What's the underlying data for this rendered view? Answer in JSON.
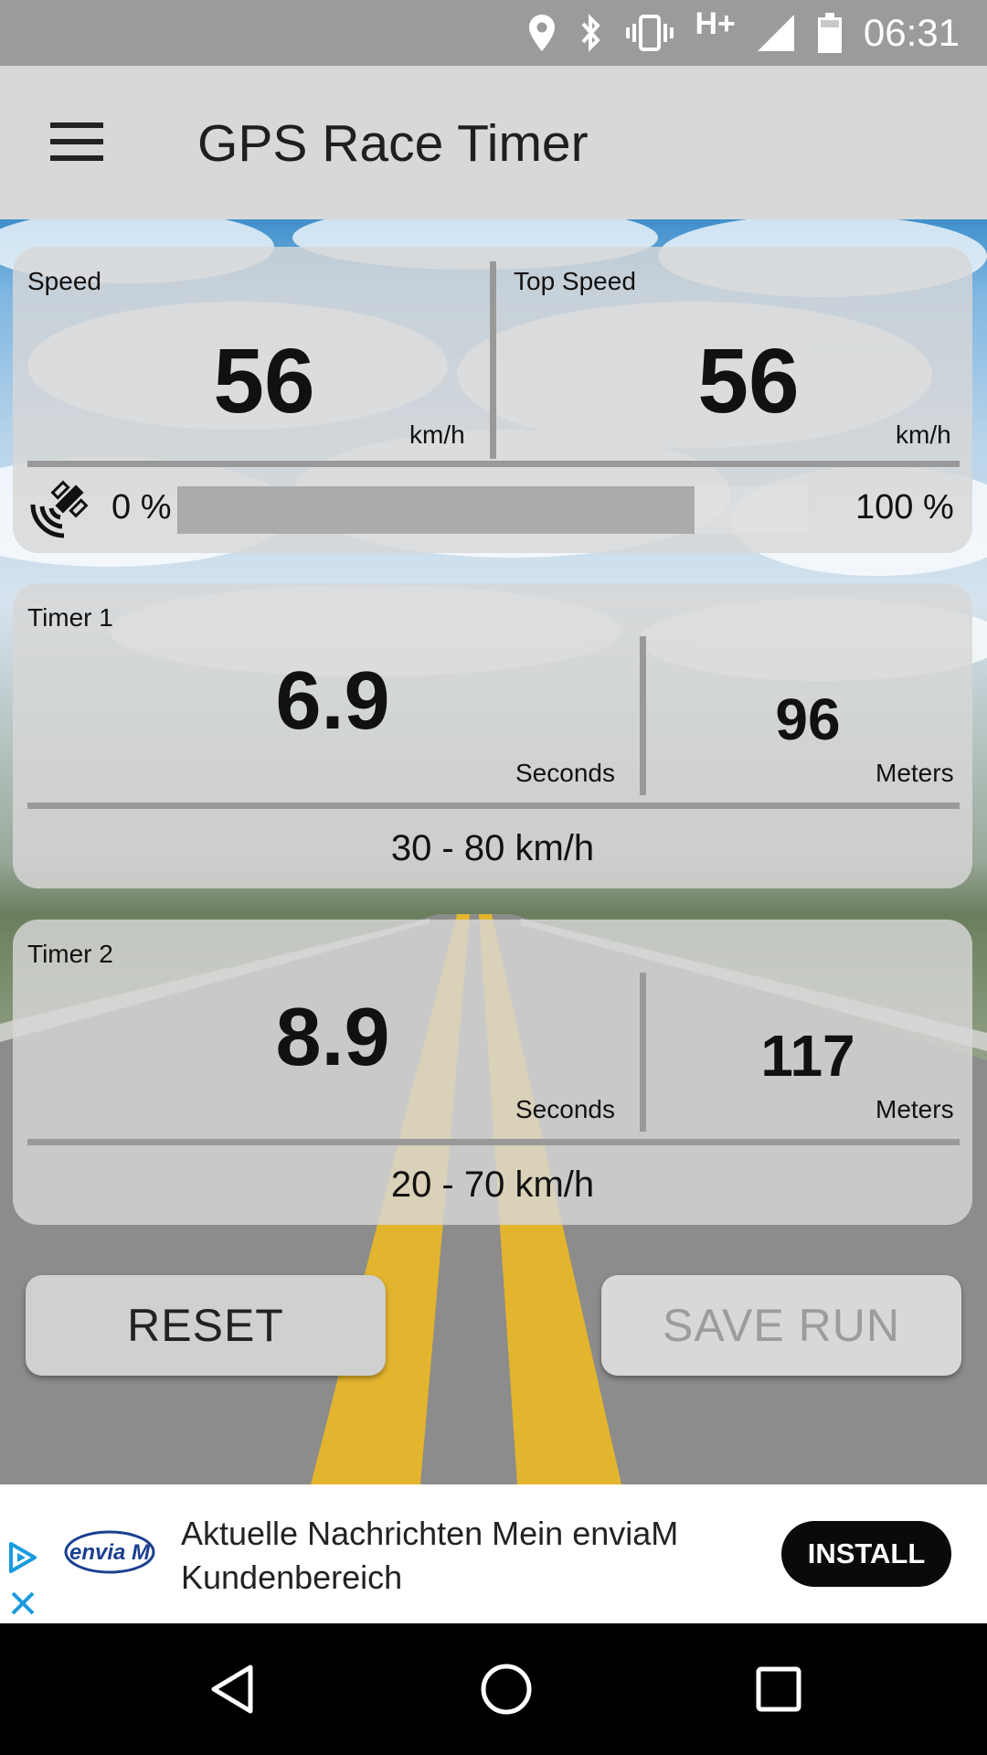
{
  "status_bar": {
    "time": "06:31",
    "network": "H+"
  },
  "app_bar": {
    "title": "GPS Race Timer"
  },
  "speed_card": {
    "speed_label": "Speed",
    "speed_value": "56",
    "speed_unit": "km/h",
    "top_speed_label": "Top Speed",
    "top_speed_value": "56",
    "top_speed_unit": "km/h",
    "gps_min_label": "0 %",
    "gps_max_label": "100 %",
    "gps_accuracy_fraction": 0.82
  },
  "timer1": {
    "label": "Timer 1",
    "seconds_value": "6.9",
    "seconds_unit": "Seconds",
    "meters_value": "96",
    "meters_unit": "Meters",
    "range": "30 - 80 km/h"
  },
  "timer2": {
    "label": "Timer 2",
    "seconds_value": "8.9",
    "seconds_unit": "Seconds",
    "meters_value": "117",
    "meters_unit": "Meters",
    "range": "20 - 70 km/h"
  },
  "buttons": {
    "reset": "RESET",
    "save_run": "SAVE RUN"
  },
  "ad": {
    "logo_text": "envia M",
    "text": "Aktuelle Nachrichten Mein enviaM Kundenbereich",
    "install": "INSTALL"
  },
  "icons": {
    "status": [
      "location-icon",
      "bluetooth-icon",
      "vibrate-icon",
      "signal-icon",
      "battery-icon"
    ],
    "nav": [
      "back-icon",
      "home-icon",
      "recents-icon"
    ]
  },
  "colors": {
    "accent": "#0a0a0a",
    "ad_icon": "#1a9ae0"
  }
}
